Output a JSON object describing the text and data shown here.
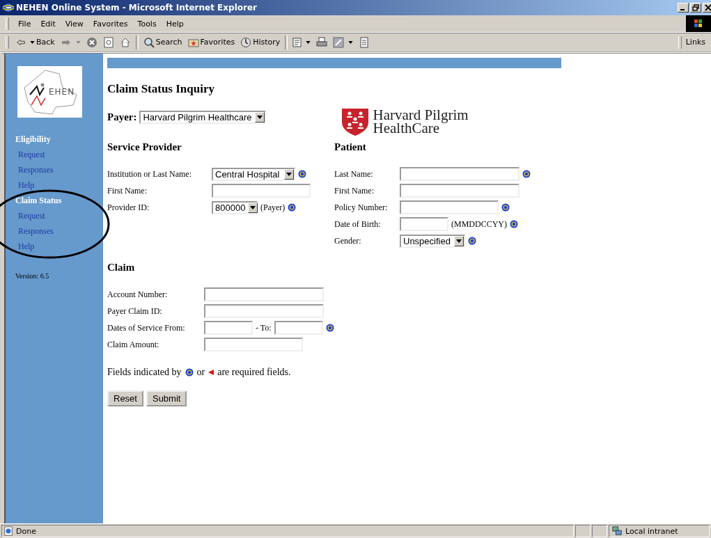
{
  "window": {
    "title": "NEHEN Online System - Microsoft Internet Explorer"
  },
  "menu": [
    "File",
    "Edit",
    "View",
    "Favorites",
    "Tools",
    "Help"
  ],
  "toolbar": [
    {
      "kind": "back",
      "label": "Back"
    },
    {
      "kind": "forward"
    },
    {
      "kind": "stop"
    },
    {
      "kind": "refresh"
    },
    {
      "kind": "home"
    },
    {
      "kind": "search",
      "label": "Search"
    },
    {
      "kind": "favorites",
      "label": "Favorites"
    },
    {
      "kind": "history",
      "label": "History"
    },
    {
      "kind": "mail"
    },
    {
      "kind": "print"
    },
    {
      "kind": "edit"
    },
    {
      "kind": "discuss"
    }
  ],
  "links_label": "Links",
  "sidebar": {
    "logo_text": "EHEN",
    "sections": [
      {
        "title": "Eligibility",
        "items": [
          "Request",
          "Responses",
          "Help"
        ]
      },
      {
        "title": "Claim Status",
        "items": [
          "Request",
          "Responses",
          "Help"
        ]
      }
    ],
    "version": "Version: 6.5"
  },
  "page": {
    "title": "Claim Status Inquiry",
    "payer_label": "Payer:",
    "payer_value": "Harvard Pilgrim Healthcare",
    "payer_logo": [
      "Harvard Pilgrim",
      "HealthCare"
    ],
    "provider": {
      "heading": "Service Provider",
      "fields": [
        {
          "label": "Institution or Last Name:",
          "kind": "select",
          "value": "Central Hospital",
          "required": true
        },
        {
          "label": "First Name:",
          "kind": "text",
          "required": false
        },
        {
          "label": "Provider ID:",
          "kind": "select",
          "value": "800000",
          "note": "(Payer)",
          "required": true
        }
      ]
    },
    "patient": {
      "heading": "Patient",
      "fields": [
        {
          "label": "Last Name:",
          "kind": "text",
          "required": true
        },
        {
          "label": "First Name:",
          "kind": "text",
          "required": false
        },
        {
          "label": "Policy Number:",
          "kind": "text",
          "required": true
        },
        {
          "label": "Date of Birth:",
          "kind": "text",
          "note": "(MMDDCCYY)",
          "required": true
        },
        {
          "label": "Gender:",
          "kind": "select",
          "value": "Unspecified",
          "required": true
        }
      ]
    },
    "claim": {
      "heading": "Claim",
      "fields": [
        {
          "label": "Account Number:",
          "kind": "text",
          "required": false
        },
        {
          "label": "Payer Claim ID:",
          "kind": "text",
          "required": false
        },
        {
          "label": "Dates of Service From:",
          "kind": "range",
          "separator": "- To:",
          "required": true
        },
        {
          "label": "Claim Amount:",
          "kind": "text",
          "required": false
        }
      ]
    },
    "required_note": [
      "Fields indicated by",
      "or",
      "are required fields."
    ],
    "buttons": [
      "Reset",
      "Submit"
    ]
  },
  "status_bar": {
    "text": "Done",
    "zone": "Local intranet"
  }
}
